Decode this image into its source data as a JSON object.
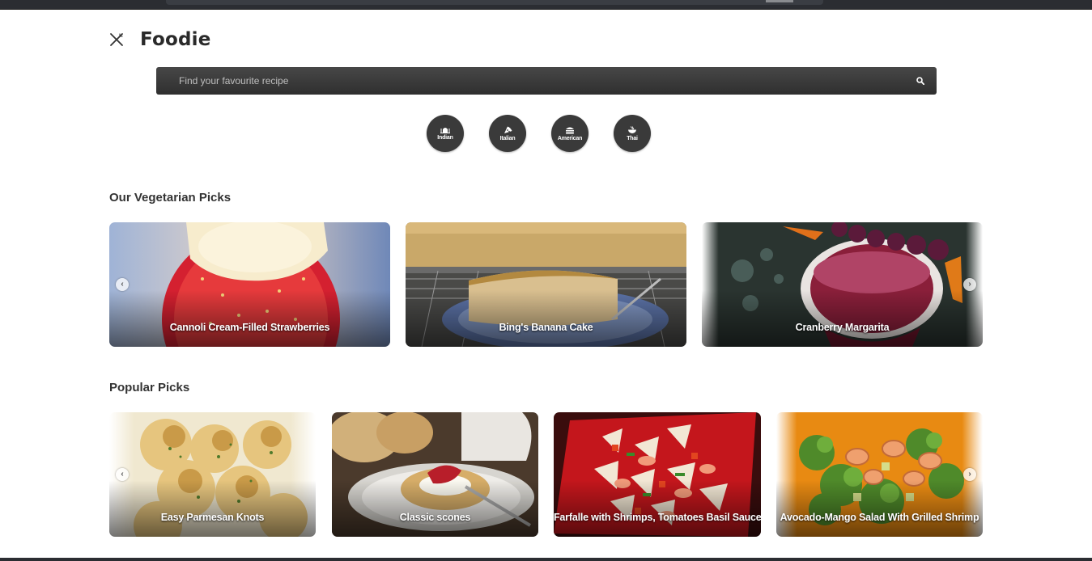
{
  "app": {
    "name": "Foodie",
    "logo_icon": "fork-knife-icon"
  },
  "search": {
    "placeholder": "Find your favourite recipe",
    "icon": "search-icon"
  },
  "cuisines": [
    {
      "label": "Indian",
      "icon": "taj-mahal-icon"
    },
    {
      "label": "Italian",
      "icon": "pizza-slice-icon"
    },
    {
      "label": "American",
      "icon": "burger-icon"
    },
    {
      "label": "Thai",
      "icon": "noodle-bowl-icon"
    }
  ],
  "vegetarian": {
    "title": "Our Vegetarian Picks",
    "cards": [
      {
        "title": "Cannoli Cream-Filled Strawberries"
      },
      {
        "title": "Bing's Banana Cake"
      },
      {
        "title": "Cranberry Margarita"
      }
    ]
  },
  "popular": {
    "title": "Popular Picks",
    "cards": [
      {
        "title": "Easy Parmesan Knots"
      },
      {
        "title": "Classic scones"
      },
      {
        "title": "Farfalle with Shrimps, Tomatoes Basil Sauce"
      },
      {
        "title": "Avocado-Mango Salad With Grilled Shrimp"
      }
    ]
  },
  "carousel": {
    "prev_icon": "chevron-left-icon",
    "next_icon": "chevron-right-icon"
  },
  "colors": {
    "search_bar": "#3a3a3a",
    "cuisine_button": "#3a3a3a",
    "text": "#333333"
  }
}
